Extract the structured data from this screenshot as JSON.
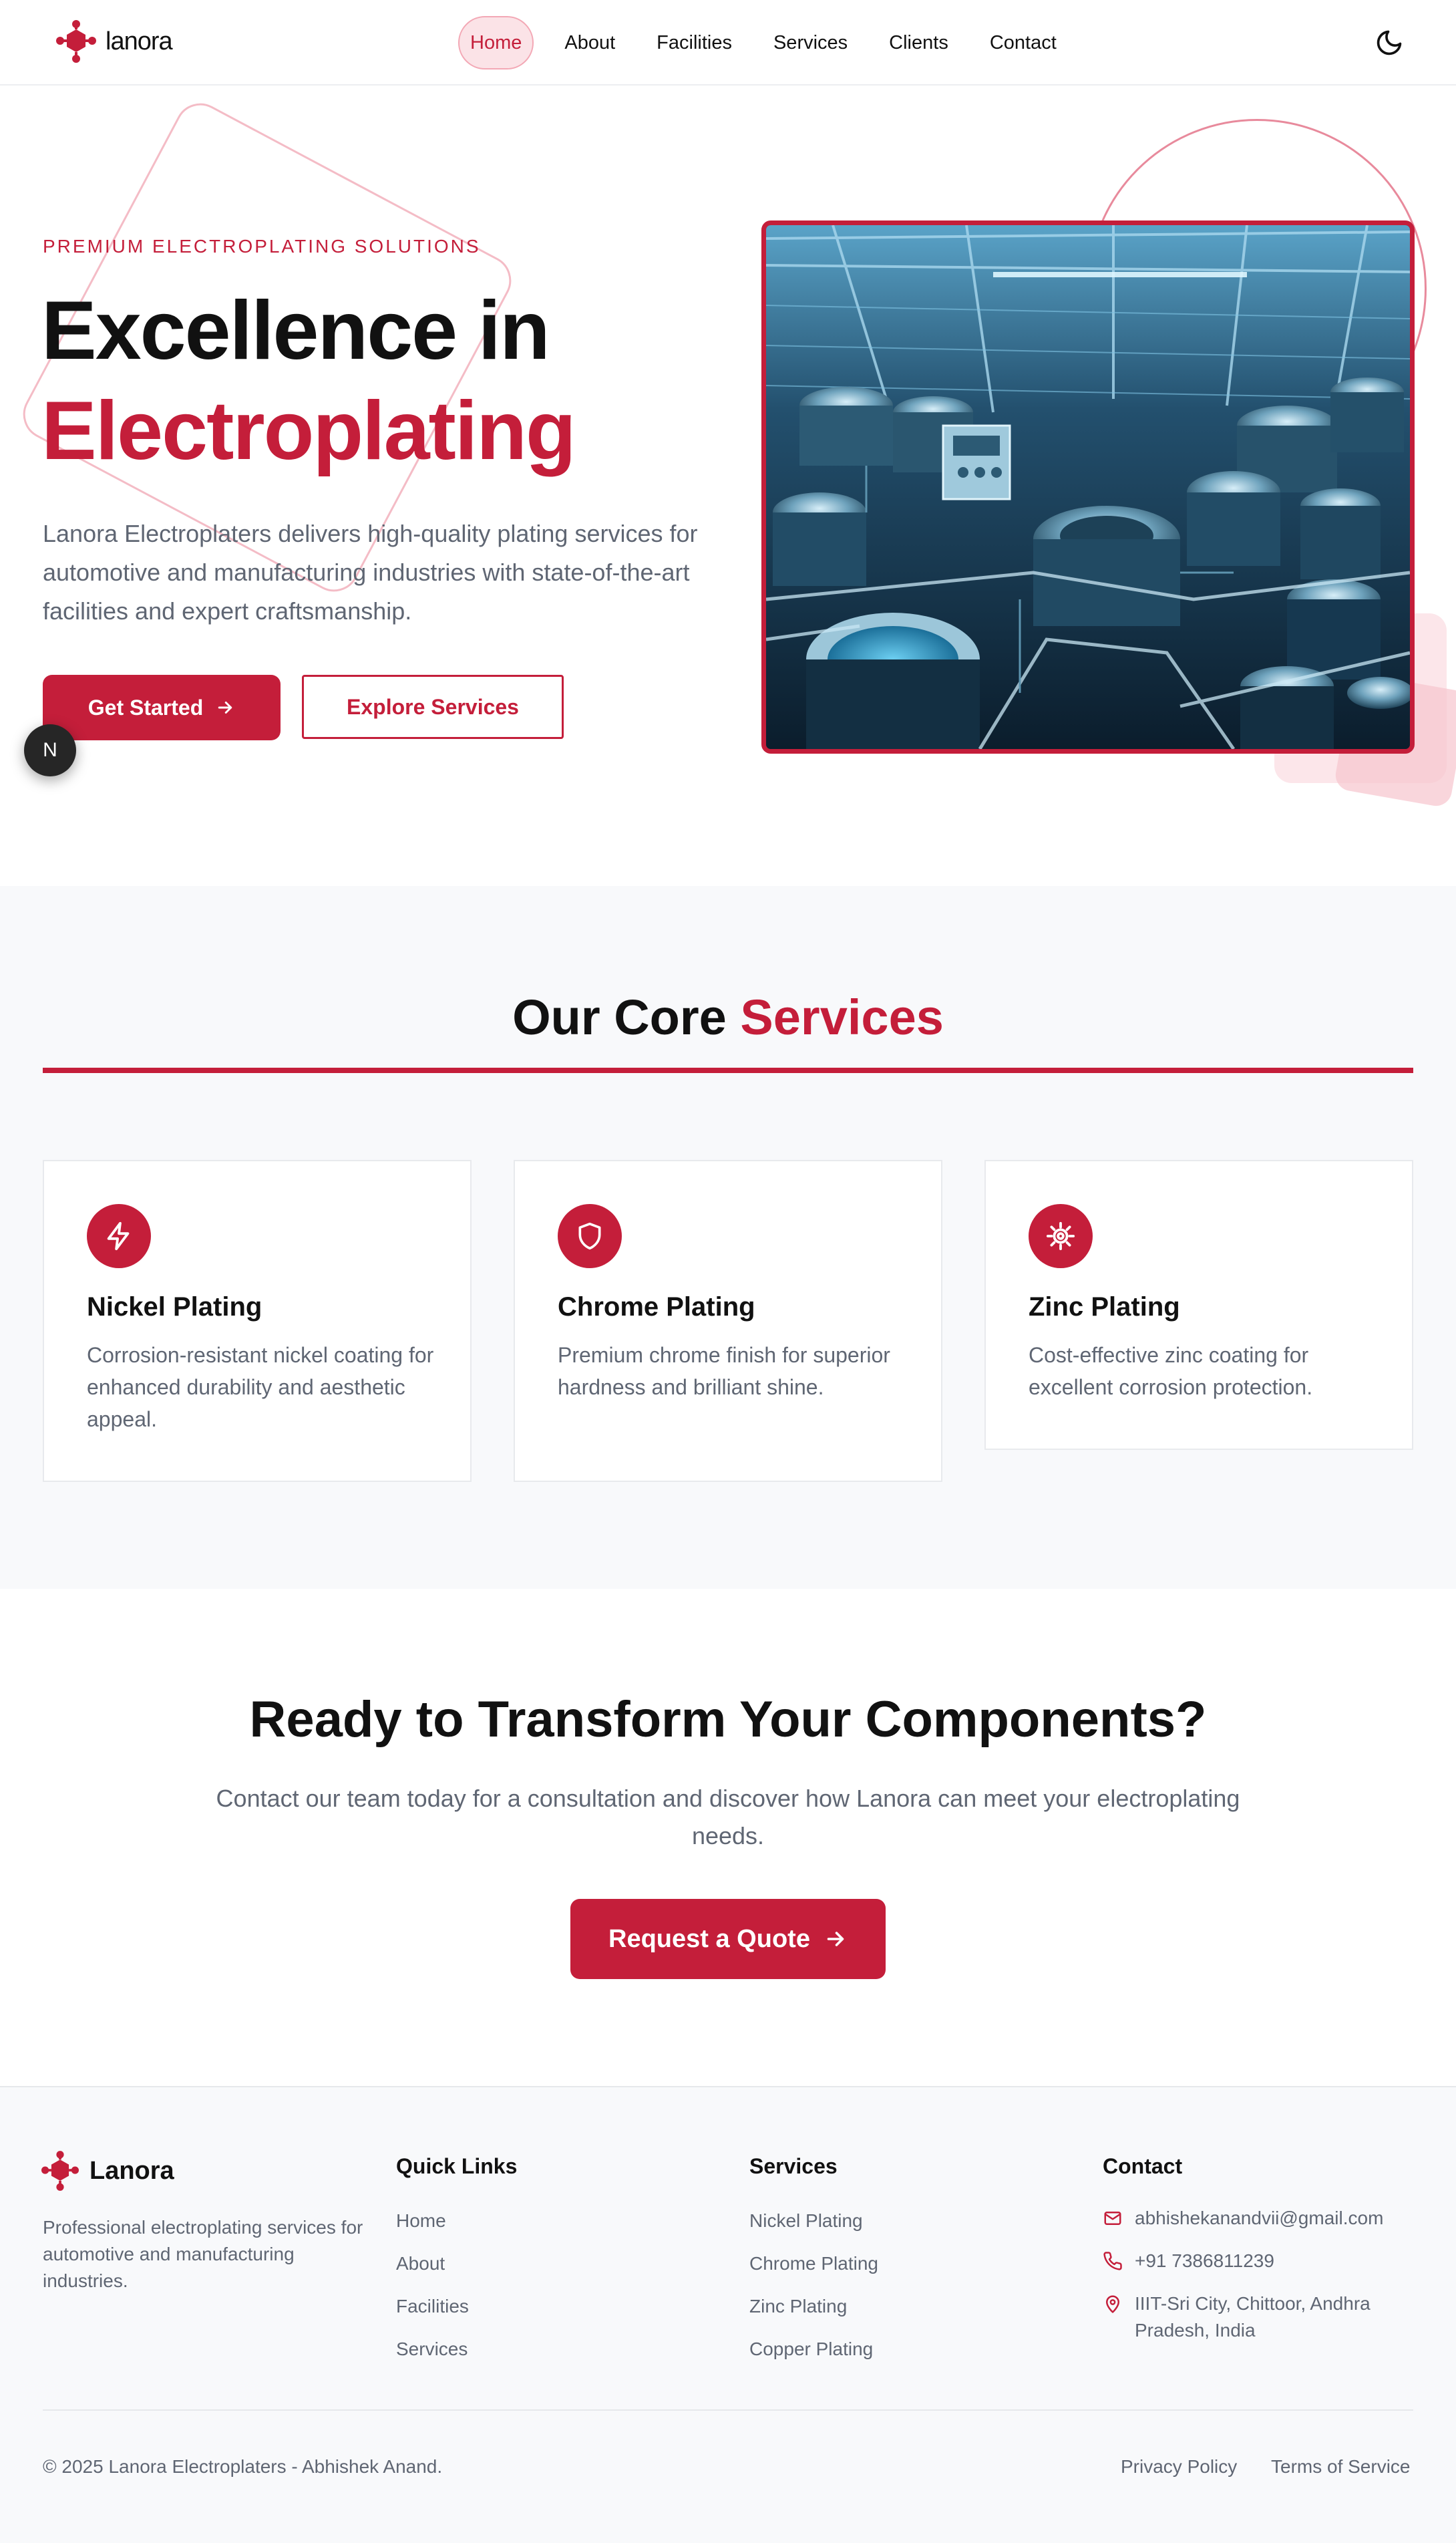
{
  "nav": {
    "brand": "lanora",
    "links": [
      {
        "label": "Home",
        "active": true
      },
      {
        "label": "About",
        "active": false
      },
      {
        "label": "Facilities",
        "active": false
      },
      {
        "label": "Services",
        "active": false
      },
      {
        "label": "Clients",
        "active": false
      },
      {
        "label": "Contact",
        "active": false
      }
    ],
    "theme_toggle_icon": "moon-icon"
  },
  "hero": {
    "eyebrow": "PREMIUM ELECTROPLATING SOLUTIONS",
    "title_line1": "Excellence in",
    "title_line2": "Electroplating",
    "description": "Lanora Electroplaters delivers high-quality plating services for automotive and manufacturing industries with state-of-the-art facilities and expert craftsmanship.",
    "primary_button": "Get Started",
    "secondary_button": "Explore Services",
    "floating_badge": "N"
  },
  "services": {
    "title_prefix": "Our Core",
    "title_accent": "Services",
    "cards": [
      {
        "icon": "lightning-icon",
        "title": "Nickel Plating",
        "description": "Corrosion-resistant nickel coating for enhanced durability and aesthetic appeal."
      },
      {
        "icon": "shield-icon",
        "title": "Chrome Plating",
        "description": "Premium chrome finish for superior hardness and brilliant shine."
      },
      {
        "icon": "gear-icon",
        "title": "Zinc Plating",
        "description": "Cost-effective zinc coating for excellent corrosion protection."
      }
    ]
  },
  "cta": {
    "title": "Ready to Transform Your Components?",
    "description": "Contact our team today for a consultation and discover how Lanora can meet your electroplating needs.",
    "button": "Request a Quote"
  },
  "footer": {
    "brand": "Lanora",
    "description": "Professional electroplating services for automotive and manufacturing industries.",
    "quick_links_title": "Quick Links",
    "quick_links": [
      "Home",
      "About",
      "Facilities",
      "Services"
    ],
    "services_title": "Services",
    "services": [
      "Nickel Plating",
      "Chrome Plating",
      "Zinc Plating",
      "Copper Plating"
    ],
    "contact_title": "Contact",
    "email": "abhishekanandvii@gmail.com",
    "phone": "+91 7386811239",
    "address": "IIIT-Sri City, Chittoor, Andhra Pradesh, India",
    "copyright": "© 2025 Lanora Electroplaters - Abhishek Anand.",
    "privacy": "Privacy Policy",
    "terms": "Terms of Service"
  },
  "colors": {
    "accent": "#c41e3a",
    "text": "#111111",
    "muted": "#5f6673",
    "section_bg": "#f8f9fb"
  }
}
